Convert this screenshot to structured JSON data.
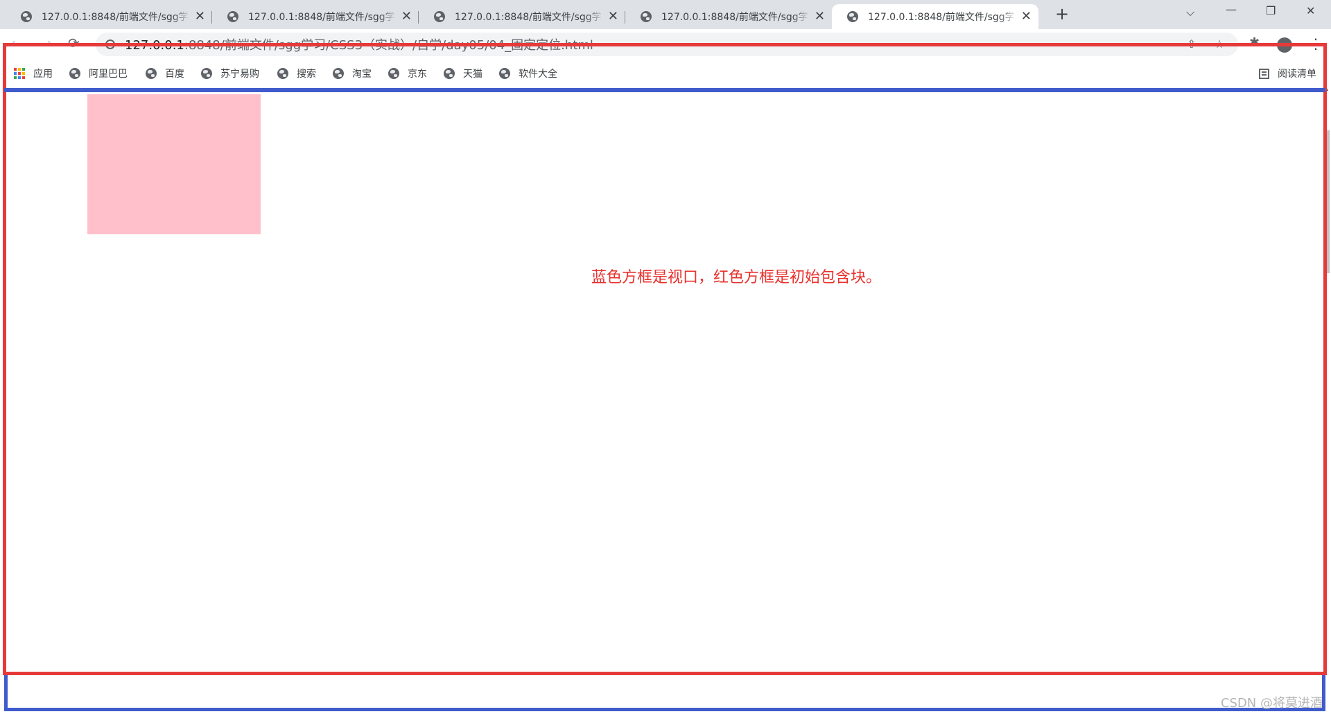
{
  "tabs": [
    {
      "title": "127.0.0.1:8848/前端文件/sgg学",
      "active": false
    },
    {
      "title": "127.0.0.1:8848/前端文件/sgg学",
      "active": false
    },
    {
      "title": "127.0.0.1:8848/前端文件/sgg学",
      "active": false
    },
    {
      "title": "127.0.0.1:8848/前端文件/sgg学",
      "active": false
    },
    {
      "title": "127.0.0.1:8848/前端文件/sgg学",
      "active": true
    }
  ],
  "window_controls": {
    "tab_search": "⌵",
    "minimize": "—",
    "restore": "❐",
    "close": "✕",
    "new_tab": "+"
  },
  "toolbar": {
    "back": "←",
    "forward": "→",
    "reload": "⟳",
    "url_host": "127.0.0.1",
    "url_path": ":8848/前端文件/sgg学习/CSS3（实战）/自学/day05/04_固定定位.html",
    "share": "⇪",
    "bookmark_star": "☆",
    "extensions": "✱",
    "menu": "⋮"
  },
  "bookmarks": {
    "apps_label": "应用",
    "items": [
      "阿里巴巴",
      "百度",
      "苏宁易购",
      "搜索",
      "淘宝",
      "京东",
      "天猫",
      "软件大全"
    ],
    "reading_list": "阅读清单"
  },
  "page": {
    "caption": "蓝色方框是视口，红色方框是初始包含块。",
    "box_color": "#ffc0cb",
    "caption_color": "#e8312c",
    "viewport_frame_color": "#3f5bcc",
    "containing_block_frame_color": "#e63a3a"
  },
  "watermark": "CSDN @将莫进酒"
}
